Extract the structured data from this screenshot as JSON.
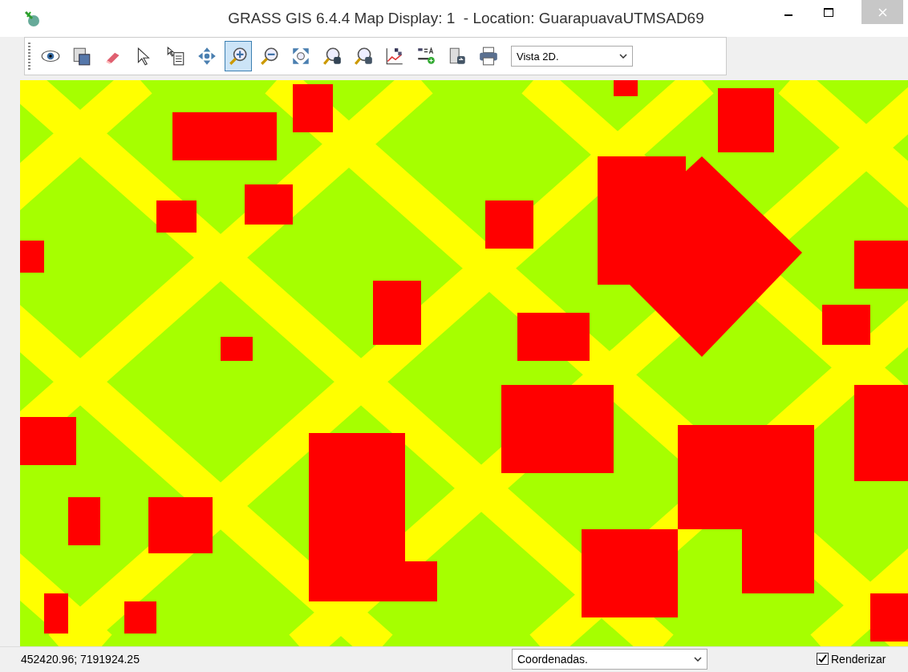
{
  "window": {
    "title": "GRASS GIS 6.4.4 Map Display: 1  - Location: GuarapuavaUTMSAD69"
  },
  "toolbar": {
    "tools": [
      {
        "kind": "eye",
        "selected": false
      },
      {
        "kind": "overlay",
        "selected": false
      },
      {
        "kind": "eraser",
        "selected": false
      },
      {
        "kind": "pointer",
        "selected": false
      },
      {
        "kind": "query",
        "selected": false
      },
      {
        "kind": "pan",
        "selected": false
      },
      {
        "kind": "zoomin",
        "selected": true
      },
      {
        "kind": "zoomout",
        "selected": false
      },
      {
        "kind": "extent",
        "selected": false
      },
      {
        "kind": "zoomback",
        "selected": false
      },
      {
        "kind": "zoommenu",
        "selected": false
      },
      {
        "kind": "analyze",
        "selected": false
      },
      {
        "kind": "decorate",
        "selected": false
      },
      {
        "kind": "export",
        "selected": false
      },
      {
        "kind": "print",
        "selected": false
      }
    ],
    "view_select": {
      "value": "Vista 2D."
    }
  },
  "status_bar": {
    "coordinates": "452420.96; 7191924.25",
    "mode_select": {
      "value": "Coordenadas."
    },
    "render": {
      "label": "Renderizar",
      "checked": true
    }
  }
}
